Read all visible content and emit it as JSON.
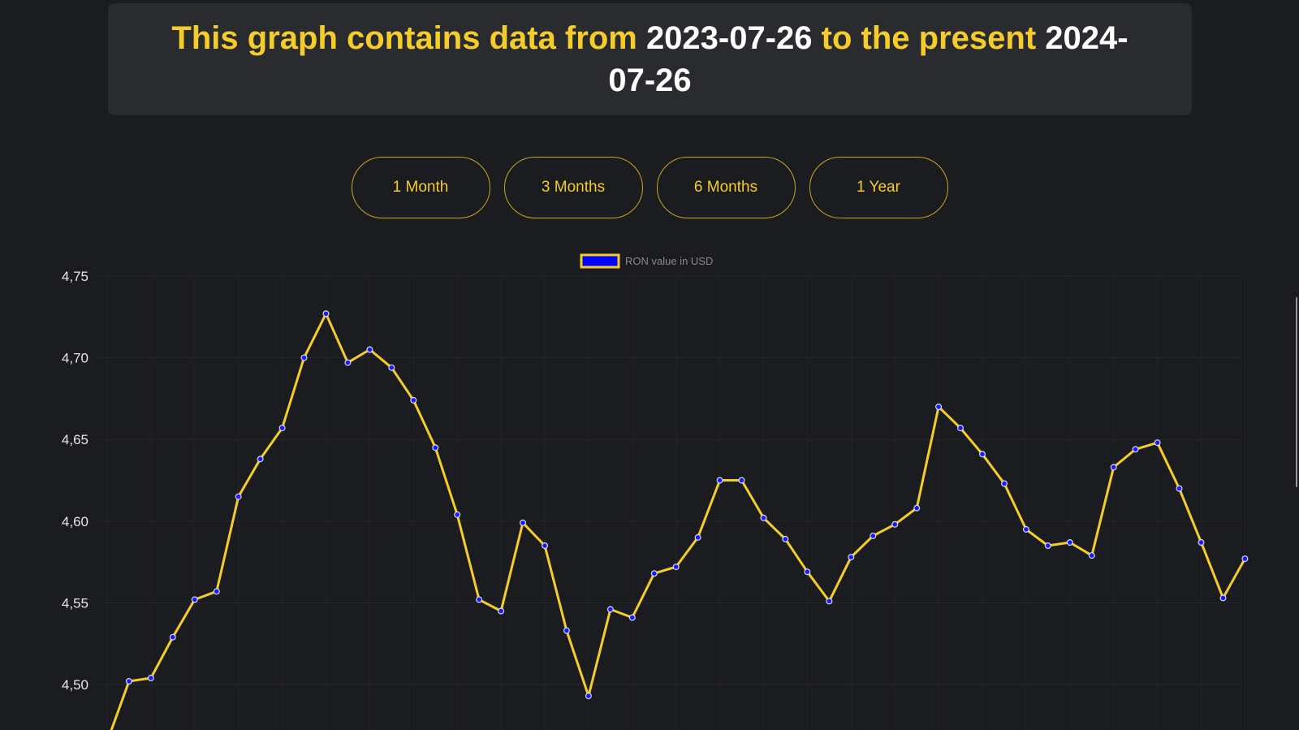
{
  "banner": {
    "prefix": "This graph contains data from ",
    "start_date": "2023-07-26",
    "middle": " to the present ",
    "end_date": "2024-07-26"
  },
  "range_buttons": [
    {
      "label": "1 Month"
    },
    {
      "label": "3 Months"
    },
    {
      "label": "6 Months"
    },
    {
      "label": "1 Year"
    }
  ],
  "colors": {
    "accent": "#f5cd2a",
    "line": "#f5cd2a",
    "point": "#1a1aff",
    "legend_fill": "#0000ff",
    "background": "#1b1c20",
    "panel": "#2a2b2f"
  },
  "chart_data": {
    "type": "line",
    "legend": "RON value in USD",
    "legend_position": "top-center",
    "grid": true,
    "y_ticks": [
      "4,75",
      "4,70",
      "4,65",
      "4,60",
      "4,55",
      "4,50"
    ],
    "ylim": [
      4.47,
      4.75
    ],
    "series": [
      {
        "name": "RON value in USD",
        "values": [
          4.465,
          4.502,
          4.504,
          4.529,
          4.552,
          4.557,
          4.615,
          4.638,
          4.657,
          4.7,
          4.727,
          4.697,
          4.705,
          4.694,
          4.674,
          4.645,
          4.604,
          4.552,
          4.545,
          4.599,
          4.585,
          4.533,
          4.493,
          4.546,
          4.541,
          4.568,
          4.572,
          4.59,
          4.625,
          4.625,
          4.602,
          4.589,
          4.569,
          4.551,
          4.578,
          4.591,
          4.598,
          4.608,
          4.67,
          4.657,
          4.641,
          4.623,
          4.595,
          4.585,
          4.587,
          4.579,
          4.633,
          4.644,
          4.648,
          4.62,
          4.587,
          4.553,
          4.577
        ]
      }
    ]
  }
}
